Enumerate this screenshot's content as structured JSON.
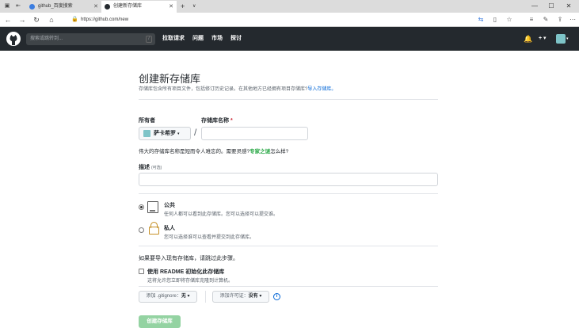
{
  "browser": {
    "tabs": [
      {
        "label": "github_百度搜索"
      },
      {
        "label": "创建新存储库"
      }
    ],
    "new_tab": "+",
    "tab_menu": "∨",
    "url": "https://github.com/new"
  },
  "header": {
    "search_placeholder": "搜索或跳转到...",
    "search_shortcut": "/",
    "nav": [
      "拉取请求",
      "问题",
      "市场",
      "探讨"
    ],
    "plus": "+ ▾"
  },
  "page": {
    "title": "创建新存储库",
    "subtitle": "存储库包含所有项目文件，包括修订历史记录。在其他地方已经拥有项目存储库?",
    "import_link": "导入存储库。",
    "owner_label": "所有者",
    "repo_label": "存储库名称",
    "required_mark": "*",
    "owner_value": "萨卡希罗",
    "separator": "/",
    "name_hint_prefix": "伟大的存储库名称是短而令人难忘的。需要灵感?",
    "name_hint_link": "专家之谜",
    "name_hint_suffix": "怎么样?",
    "desc_label": "描述",
    "desc_optional": "(可选)",
    "public": {
      "label": "公共",
      "desc": "任何人都可以看到此存储库。您可以选择可以提交谁。"
    },
    "private": {
      "label": "私人",
      "desc": "您可以选择谁可以查看并提交到此存储库。"
    },
    "import_note": "如果要导入现有存储库，请跳过此步骤。",
    "readme_label": "使用 README 初始化此存储库",
    "readme_desc": "这将允许您立即将存储库克隆到计算机。",
    "gitignore_prefix": "添加 .gitignore：",
    "gitignore_value": "无 ▾",
    "license_prefix": "添加许可证：",
    "license_value": "没有 ▾",
    "info_icon": "i",
    "create_button": "创建存储库"
  }
}
